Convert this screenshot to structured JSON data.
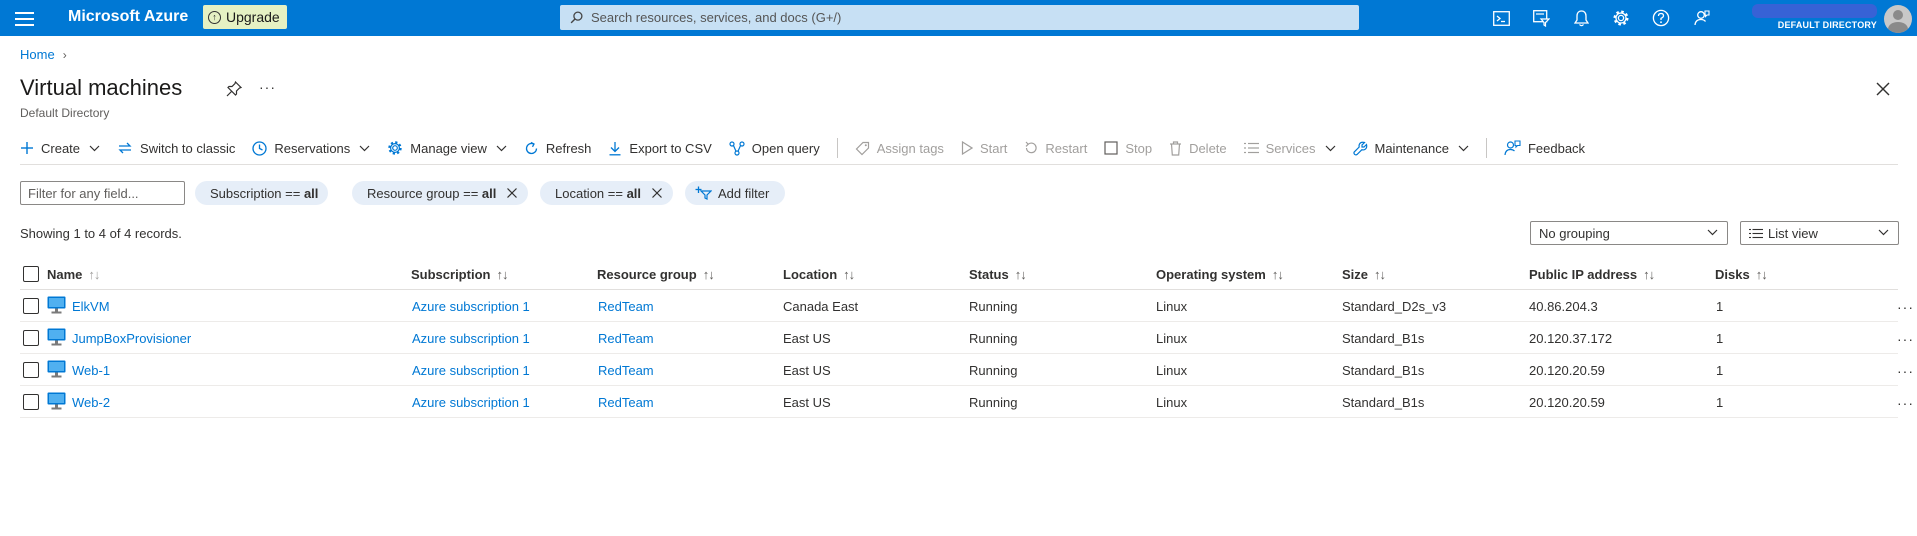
{
  "topbar": {
    "brand": "Microsoft Azure",
    "upgrade_label": "Upgrade",
    "search_placeholder": "Search resources, services, and docs (G+/)",
    "directory": "DEFAULT DIRECTORY",
    "icons": [
      "cloud-shell-icon",
      "directory-filter-icon",
      "notifications-icon",
      "settings-icon",
      "help-icon",
      "feedback-icon"
    ]
  },
  "breadcrumb": {
    "home": "Home",
    "separator": "›"
  },
  "header": {
    "title": "Virtual machines",
    "subtitle": "Default Directory",
    "more": "···"
  },
  "toolbar": {
    "create": "Create",
    "switch_classic": "Switch to classic",
    "reservations": "Reservations",
    "manage_view": "Manage view",
    "refresh": "Refresh",
    "export_csv": "Export to CSV",
    "open_query": "Open query",
    "assign_tags": "Assign tags",
    "start": "Start",
    "restart": "Restart",
    "stop": "Stop",
    "delete": "Delete",
    "services": "Services",
    "maintenance": "Maintenance",
    "feedback": "Feedback"
  },
  "filters": {
    "placeholder": "Filter for any field...",
    "subscription": {
      "label": "Subscription == ",
      "value": "all"
    },
    "resource_group": {
      "label": "Resource group == ",
      "value": "all"
    },
    "location": {
      "label": "Location == ",
      "value": "all"
    },
    "add_filter": "Add filter"
  },
  "records_text": "Showing 1 to 4 of 4 records.",
  "grouping": "No grouping",
  "view_mode": "List view",
  "table": {
    "columns": {
      "name": "Name",
      "subscription": "Subscription",
      "resource_group": "Resource group",
      "location": "Location",
      "status": "Status",
      "os": "Operating system",
      "size": "Size",
      "public_ip": "Public IP address",
      "disks": "Disks"
    },
    "sort_glyph": "↑↓",
    "row_more": "···",
    "rows": [
      {
        "name": "ElkVM",
        "subscription": "Azure subscription 1",
        "resource_group": "RedTeam",
        "location": "Canada East",
        "status": "Running",
        "os": "Linux",
        "size": "Standard_D2s_v3",
        "public_ip": "40.86.204.3",
        "disks": "1"
      },
      {
        "name": "JumpBoxProvisioner",
        "subscription": "Azure subscription 1",
        "resource_group": "RedTeam",
        "location": "East US",
        "status": "Running",
        "os": "Linux",
        "size": "Standard_B1s",
        "public_ip": "20.120.37.172",
        "disks": "1"
      },
      {
        "name": "Web-1",
        "subscription": "Azure subscription 1",
        "resource_group": "RedTeam",
        "location": "East US",
        "status": "Running",
        "os": "Linux",
        "size": "Standard_B1s",
        "public_ip": "20.120.20.59",
        "disks": "1"
      },
      {
        "name": "Web-2",
        "subscription": "Azure subscription 1",
        "resource_group": "RedTeam",
        "location": "East US",
        "status": "Running",
        "os": "Linux",
        "size": "Standard_B1s",
        "public_ip": "20.120.20.59",
        "disks": "1"
      }
    ]
  },
  "colors": {
    "brand_blue": "#0078d4",
    "link": "#0078d4",
    "upgrade_bg": "#e5f1c3",
    "pill_bg": "#e6eef8"
  }
}
